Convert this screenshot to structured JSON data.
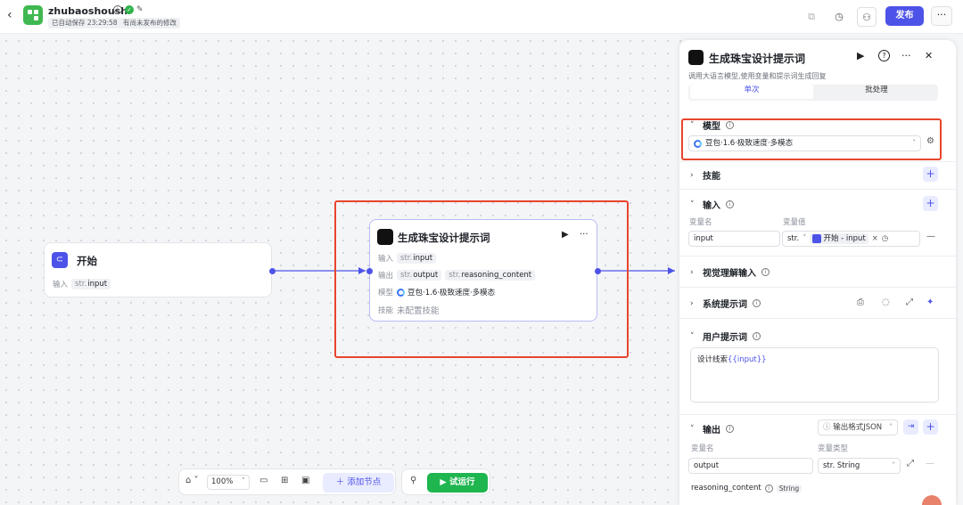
{
  "header": {
    "app_name": "zhubaoshoushi",
    "autosave": "已自动保存 23:29:58",
    "unpublished": "有尚未发布的修改",
    "publish_label": "发布",
    "more": "···"
  },
  "canvas": {
    "start_node": {
      "title": "开始",
      "input_label": "输入",
      "input_type": "str.",
      "input_name": "input"
    },
    "llm_node": {
      "title": "生成珠宝设计提示词",
      "input_label": "输入",
      "input_type": "str.",
      "input_name": "input",
      "output_label": "输出",
      "output_type": "str.",
      "output_1": "output",
      "output_2": "reasoning_content",
      "model_label": "模型",
      "model_value": "豆包·1.6·极致速度·多模态",
      "skill_label": "技能",
      "skill_value": "未配置技能"
    }
  },
  "toolbar": {
    "zoom": "100%",
    "add_node": "添加节点",
    "trial_run": "试运行"
  },
  "panel": {
    "title": "生成珠宝设计提示词",
    "description": "调用大语言模型,使用变量和提示词生成回复",
    "tab_single": "单次",
    "tab_batch": "批处理",
    "model_section": "模型",
    "model_value": "豆包·1.6·极致速度·多模态",
    "skill_section": "技能",
    "input_section": "输入",
    "var_name_label": "变量名",
    "var_value_label": "变量值",
    "input_var_name": "input",
    "input_var_type": "str.",
    "input_var_ref": "开始 - input",
    "vision_section": "视觉理解输入",
    "system_prompt_section": "系统提示词",
    "user_prompt_section": "用户提示词",
    "user_prompt_text": "设计线索",
    "user_prompt_var": "{{input}}",
    "output_section": "输出",
    "output_format": "输出格式JSON",
    "out_var_name_label": "变量名",
    "out_var_type_label": "变量类型",
    "output_var_name": "output",
    "output_var_type": "str. String",
    "reasoning_name": "reasoning_content",
    "reasoning_type": "String"
  },
  "colors": {
    "accent": "#4d53e8",
    "highlight_box": "#e8452c",
    "run_green": "#1fb54f",
    "app_green": "#3fb84f"
  },
  "icons": [
    "back-icon",
    "workflow-icon",
    "info-icon",
    "verified-icon",
    "edit-icon",
    "copy-icon",
    "history-icon",
    "users-icon",
    "play-icon",
    "help-icon",
    "close-icon",
    "settings-icon",
    "plus-icon",
    "clock-icon",
    "expand-icon",
    "magic-icon",
    "mouse-icon",
    "comment-icon",
    "layout-icon",
    "minimap-icon",
    "link-icon"
  ]
}
